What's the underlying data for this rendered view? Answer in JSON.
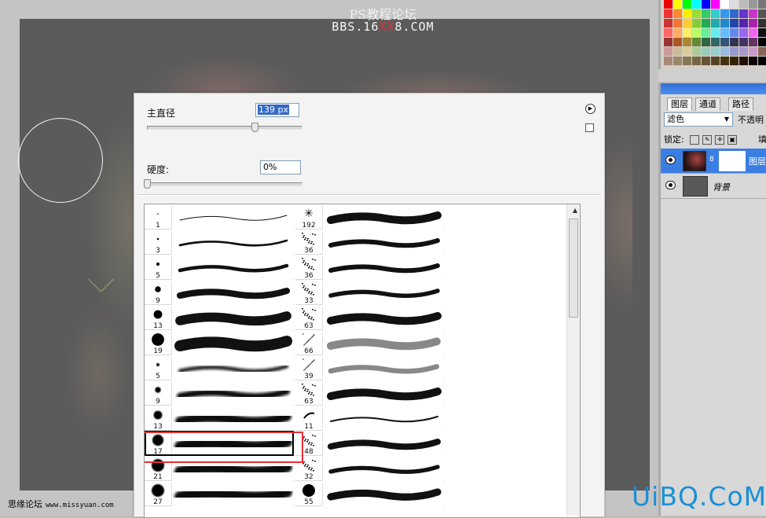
{
  "watermark": {
    "title": "PS教程论坛",
    "url_prefix": "BBS.16",
    "url_red": "XX",
    "url_suffix": "8.COM",
    "site_label": "思缘论坛",
    "site_url": "www.missyuan.com",
    "brand": "UiBQ.CoM"
  },
  "brush_picker": {
    "master_diameter_label": "主直径",
    "master_diameter_value": "139 px",
    "master_diameter_level": 0.7,
    "hardness_label": "硬度:",
    "hardness_value": "0%",
    "hardness_level": 0,
    "menu_icon": "flyout-menu-icon",
    "new_preset_icon": "new-preset-icon",
    "brushes_left": [
      {
        "size": "1",
        "tip": "hard-round",
        "selected": false
      },
      {
        "size": "3",
        "tip": "hard-round",
        "selected": false
      },
      {
        "size": "5",
        "tip": "hard-round",
        "selected": false
      },
      {
        "size": "9",
        "tip": "hard-round",
        "selected": false
      },
      {
        "size": "13",
        "tip": "hard-round",
        "selected": false
      },
      {
        "size": "19",
        "tip": "hard-round",
        "selected": false
      },
      {
        "size": "5",
        "tip": "soft-round",
        "selected": false
      },
      {
        "size": "9",
        "tip": "soft-round",
        "selected": false
      },
      {
        "size": "13",
        "tip": "soft-round",
        "selected": false
      },
      {
        "size": "17",
        "tip": "soft-round",
        "selected": true
      },
      {
        "size": "21",
        "tip": "soft-round",
        "selected": false
      },
      {
        "size": "27",
        "tip": "soft-round",
        "selected": false
      }
    ],
    "brushes_right": [
      {
        "size": "192",
        "tip": "star"
      },
      {
        "size": "36",
        "tip": "textured"
      },
      {
        "size": "36",
        "tip": "textured"
      },
      {
        "size": "33",
        "tip": "textured"
      },
      {
        "size": "63",
        "tip": "textured"
      },
      {
        "size": "66",
        "tip": "spray"
      },
      {
        "size": "39",
        "tip": "spray"
      },
      {
        "size": "63",
        "tip": "textured"
      },
      {
        "size": "11",
        "tip": "leaf"
      },
      {
        "size": "48",
        "tip": "textured"
      },
      {
        "size": "32",
        "tip": "textured"
      },
      {
        "size": "55",
        "tip": "hard-round"
      }
    ]
  },
  "layers_panel": {
    "tabs": [
      "图层",
      "通道",
      "路径"
    ],
    "blend_mode": "滤色",
    "opacity_label": "不透明",
    "lock_label": "锁定:",
    "fill_label": "填",
    "layers": [
      {
        "name": "图层",
        "selected": true
      },
      {
        "name": "背景",
        "selected": false
      }
    ]
  },
  "colors": {
    "selection_highlight": "#e53030",
    "brand_blue": "#1b8fd6",
    "layer_selected": "#3a7ee4"
  }
}
